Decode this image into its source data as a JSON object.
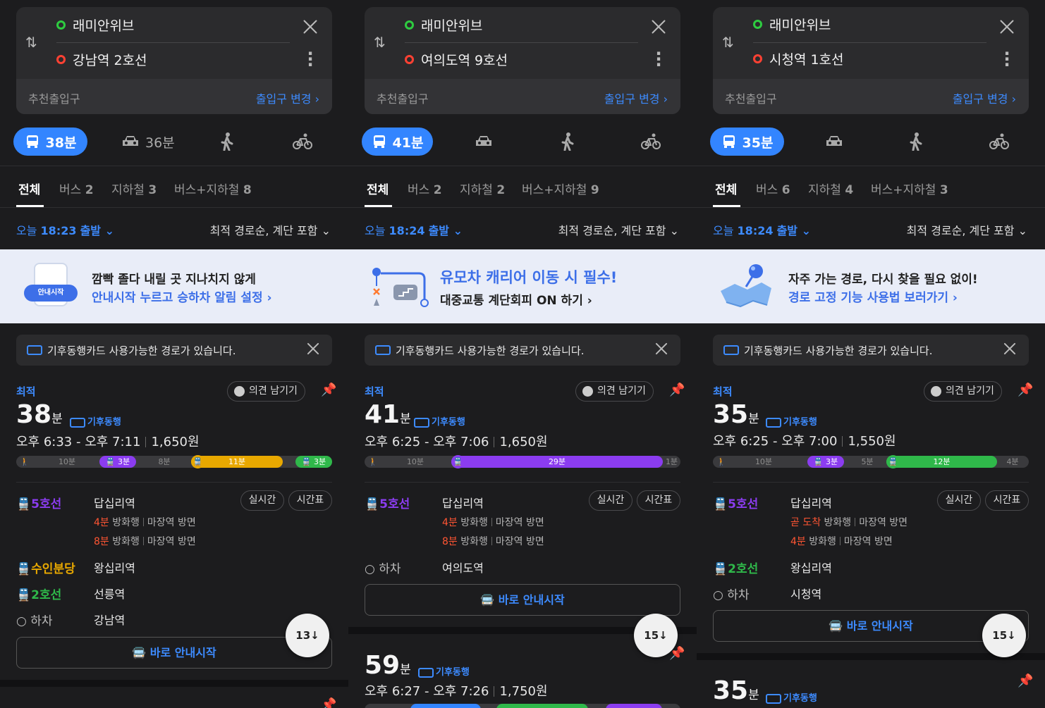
{
  "screens": [
    {
      "origin": "래미안위브",
      "destination": "강남역 2호선",
      "entry_label": "추천출입구",
      "entry_change": "출입구 변경 ›",
      "modes": {
        "transit": "38분",
        "car": "36분"
      },
      "tabs": [
        "전체",
        "버스",
        "2",
        "지하철",
        "3",
        "버스+지하철",
        "8"
      ],
      "depart": {
        "prefix": "오늘",
        "time": "18:23",
        "suffix": "출발 ⌄"
      },
      "sort": "최적 경로순, 계단 포함 ⌄",
      "banner": {
        "line1": "깜빡 졸다 내릴 곳 지나치지 않게",
        "line2": "안내시작 누르고 승하차 알림 설정 ›",
        "badge": "안내시작"
      },
      "notice": "기후동행카드 사용가능한 경로가 있습니다.",
      "route": {
        "tag": "최적",
        "opinion": "의견 남기기",
        "duration": "38",
        "unit": "분",
        "climate": "기후동행",
        "time_range": "오후 6:33 - 오후 7:11",
        "fare": "1,650원",
        "bar": [
          "10분",
          "3분",
          "8분",
          "11분",
          "3분"
        ],
        "lines": [
          {
            "name": "5호선",
            "station": "답십리역"
          },
          {
            "name": "수인분당",
            "station": "왕십리역"
          },
          {
            "name": "2호선",
            "station": "선릉역"
          }
        ],
        "arrivals": [
          {
            "t": "4분",
            "dir": "방화행",
            "ex": "마장역 방면"
          },
          {
            "t": "8분",
            "dir": "방화행",
            "ex": "마장역 방면"
          }
        ],
        "alight": "하차",
        "alight_station": "강남역",
        "realtime": "실시간",
        "timetable": "시간표",
        "go": "바로 안내시작",
        "fab": "13"
      }
    },
    {
      "origin": "래미안위브",
      "destination": "여의도역 9호선",
      "entry_label": "추천출입구",
      "entry_change": "출입구 변경 ›",
      "modes": {
        "transit": "41분"
      },
      "tabs": [
        "전체",
        "버스",
        "2",
        "지하철",
        "2",
        "버스+지하철",
        "9"
      ],
      "depart": {
        "prefix": "오늘",
        "time": "18:24",
        "suffix": "출발 ⌄"
      },
      "sort": "최적 경로순, 계단 포함 ⌄",
      "banner": {
        "line1": "유모차 캐리어 이동 시 필수!",
        "line2": "대중교통 계단회피 ON 하기 ›"
      },
      "notice": "기후동행카드 사용가능한 경로가 있습니다.",
      "route": {
        "tag": "최적",
        "opinion": "의견 남기기",
        "duration": "41",
        "unit": "분",
        "climate": "기후동행",
        "time_range": "오후 6:25 - 오후 7:06",
        "fare": "1,650원",
        "bar": [
          "10분",
          "29분",
          "1분"
        ],
        "lines": [
          {
            "name": "5호선",
            "station": "답십리역"
          }
        ],
        "arrivals": [
          {
            "t": "4분",
            "dir": "방화행",
            "ex": "마장역 방면"
          },
          {
            "t": "8분",
            "dir": "방화행",
            "ex": "마장역 방면"
          }
        ],
        "alight": "하차",
        "alight_station": "여의도역",
        "realtime": "실시간",
        "timetable": "시간표",
        "go": "바로 안내시작",
        "fab": "15"
      },
      "next": {
        "duration": "59",
        "unit": "분",
        "climate": "기후동행",
        "time_range": "오후 6:27 - 오후 7:26",
        "fare": "1,750원"
      }
    },
    {
      "origin": "래미안위브",
      "destination": "시청역 1호선",
      "entry_label": "추천출입구",
      "entry_change": "출입구 변경 ›",
      "modes": {
        "transit": "35분"
      },
      "tabs": [
        "전체",
        "버스",
        "6",
        "지하철",
        "4",
        "버스+지하철",
        "3"
      ],
      "depart": {
        "prefix": "오늘",
        "time": "18:24",
        "suffix": "출발 ⌄"
      },
      "sort": "최적 경로순, 계단 포함 ⌄",
      "banner": {
        "line1": "자주 가는 경로, 다시 찾을 필요 없이!",
        "line2": "경로 고정 기능 사용법 보러가기 ›"
      },
      "notice": "기후동행카드 사용가능한 경로가 있습니다.",
      "route": {
        "tag": "최적",
        "opinion": "의견 남기기",
        "duration": "35",
        "unit": "분",
        "climate": "기후동행",
        "time_range": "오후 6:25 - 오후 7:00",
        "fare": "1,550원",
        "bar": [
          "10분",
          "3분",
          "5분",
          "12분",
          "4분"
        ],
        "lines": [
          {
            "name": "5호선",
            "station": "답십리역"
          },
          {
            "name": "2호선",
            "station": "왕십리역"
          }
        ],
        "arrivals": [
          {
            "t": "곧 도착",
            "dir": "방화행",
            "ex": "마장역 방면"
          },
          {
            "t": "4분",
            "dir": "방화행",
            "ex": "마장역 방면"
          }
        ],
        "alight": "하차",
        "alight_station": "시청역",
        "realtime": "실시간",
        "timetable": "시간표",
        "go": "바로 안내시작",
        "fab": "15"
      },
      "next": {
        "duration": "35",
        "unit": "분",
        "climate": "기후동행"
      }
    }
  ],
  "colors": {
    "accent": "#3385ff",
    "line5": "#8b3cf0",
    "suin": "#e8a800",
    "line2": "#2fb84a",
    "alert": "#ff5533"
  },
  "icons": [
    "bus-icon",
    "car-icon",
    "walk-icon",
    "bike-icon",
    "swap-icon",
    "close-icon",
    "more-icon",
    "pin-icon",
    "smile-icon",
    "card-icon",
    "train-icon"
  ]
}
